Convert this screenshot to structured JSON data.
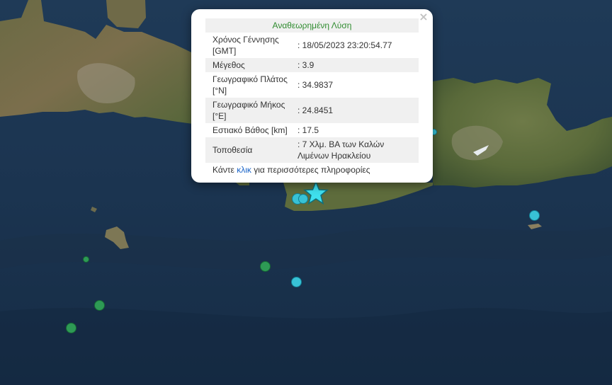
{
  "popup": {
    "heading": "Αναθεωρημένη Λύση",
    "close_symbol": "×",
    "rows": [
      {
        "label": "Χρόνος Γέννησης [GMT]",
        "value": ": 18/05/2023 23:20:54.77"
      },
      {
        "label": "Μέγεθος",
        "value": ": 3.9"
      },
      {
        "label": "Γεωγραφικό Πλάτος [°N]",
        "value": ": 34.9837"
      },
      {
        "label": "Γεωγραφικό Μήκος [°E]",
        "value": ": 24.8451"
      },
      {
        "label": "Εστιακό Βάθος [km]",
        "value": ": 17.5"
      },
      {
        "label": "Τοποθεσία",
        "value": ": 7 Χλμ. ΒΑ των Καλών Λιμένων Ηρακλείου"
      }
    ],
    "more_prefix": "Κάντε ",
    "more_link": "κλικ",
    "more_suffix": " για περισσότερες πληροφορίες"
  },
  "colors": {
    "sea": "#1c3550",
    "land": "#556b3a",
    "marker_green": "#2e9a55",
    "marker_cyan": "#38c2d6",
    "epicenter_star": "#3fe0ee",
    "heading_text": "#2e8b2e",
    "link": "#1a64c8"
  },
  "markers": [
    {
      "type": "cyan",
      "label": "earthquake-marker"
    },
    {
      "type": "cyan",
      "label": "earthquake-marker"
    },
    {
      "type": "cyan",
      "label": "earthquake-marker"
    },
    {
      "type": "cyan",
      "label": "earthquake-marker"
    },
    {
      "type": "green",
      "label": "earthquake-marker"
    },
    {
      "type": "green",
      "label": "earthquake-marker"
    },
    {
      "type": "green",
      "label": "earthquake-marker"
    },
    {
      "type": "green",
      "label": "earthquake-marker"
    }
  ],
  "epicenter": {
    "icon": "star-icon"
  }
}
